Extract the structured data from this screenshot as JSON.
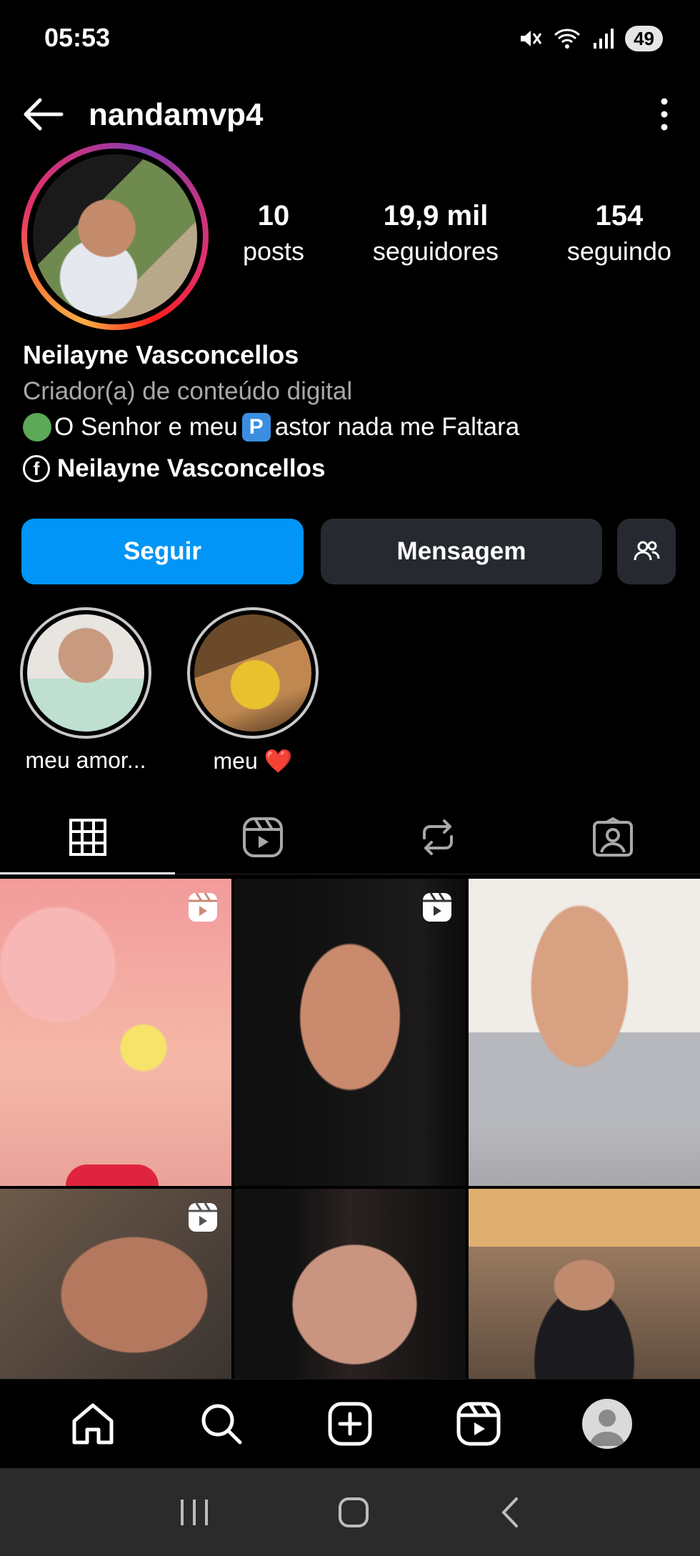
{
  "status_bar": {
    "time": "05:53",
    "battery": "49"
  },
  "header": {
    "username": "nandamvp4"
  },
  "profile": {
    "stats": [
      {
        "value": "10",
        "label": "posts"
      },
      {
        "value": "19,9 mil",
        "label": "seguidores"
      },
      {
        "value": "154",
        "label": "seguindo"
      }
    ],
    "name": "Neilayne Vasconcellos",
    "category": "Criador(a) de conteúdo digital",
    "bio_part1": "O Senhor e meu ",
    "bio_p": "P",
    "bio_part2": "astor nada me Faltara",
    "facebook_name": "Neilayne Vasconcellos"
  },
  "actions": {
    "follow": "Seguir",
    "message": "Mensagem"
  },
  "highlights": [
    {
      "label": "meu amor..."
    },
    {
      "label": "meu ❤️"
    }
  ],
  "colors": {
    "follow_blue": "#0095f6",
    "button_gray": "#262a30",
    "story_ring": "#e1306c"
  },
  "icons": {
    "tabs": [
      "grid-icon",
      "reels-icon",
      "reposts-icon",
      "tagged-icon"
    ],
    "bottom_nav": [
      "home-icon",
      "search-icon",
      "create-icon",
      "reels-icon",
      "profile-icon"
    ]
  }
}
